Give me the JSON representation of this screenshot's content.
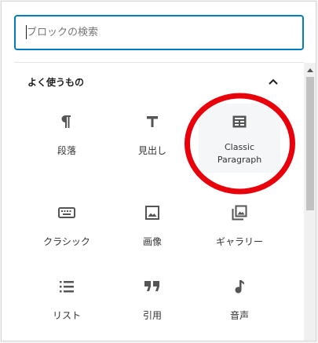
{
  "search": {
    "placeholder": "ブロックの検索"
  },
  "category": {
    "title": "よく使うもの",
    "collapse_icon": "chevron-up-icon"
  },
  "blocks": [
    {
      "label": "段落",
      "icon": "paragraph-icon"
    },
    {
      "label": "見出し",
      "icon": "heading-icon"
    },
    {
      "label": "Classic Paragraph",
      "label_line1": "Classic",
      "label_line2": "Paragraph",
      "icon": "classic-block-icon"
    },
    {
      "label": "クラシック",
      "icon": "keyboard-icon"
    },
    {
      "label": "画像",
      "icon": "image-icon"
    },
    {
      "label": "ギャラリー",
      "icon": "gallery-icon"
    },
    {
      "label": "リスト",
      "icon": "list-icon"
    },
    {
      "label": "引用",
      "icon": "quote-icon"
    },
    {
      "label": "音声",
      "icon": "audio-icon"
    }
  ],
  "annotation": {
    "color": "#e8000b"
  },
  "colors": {
    "accent": "#007cba",
    "highlight_bg": "#f5f6f7",
    "text": "#333333"
  }
}
